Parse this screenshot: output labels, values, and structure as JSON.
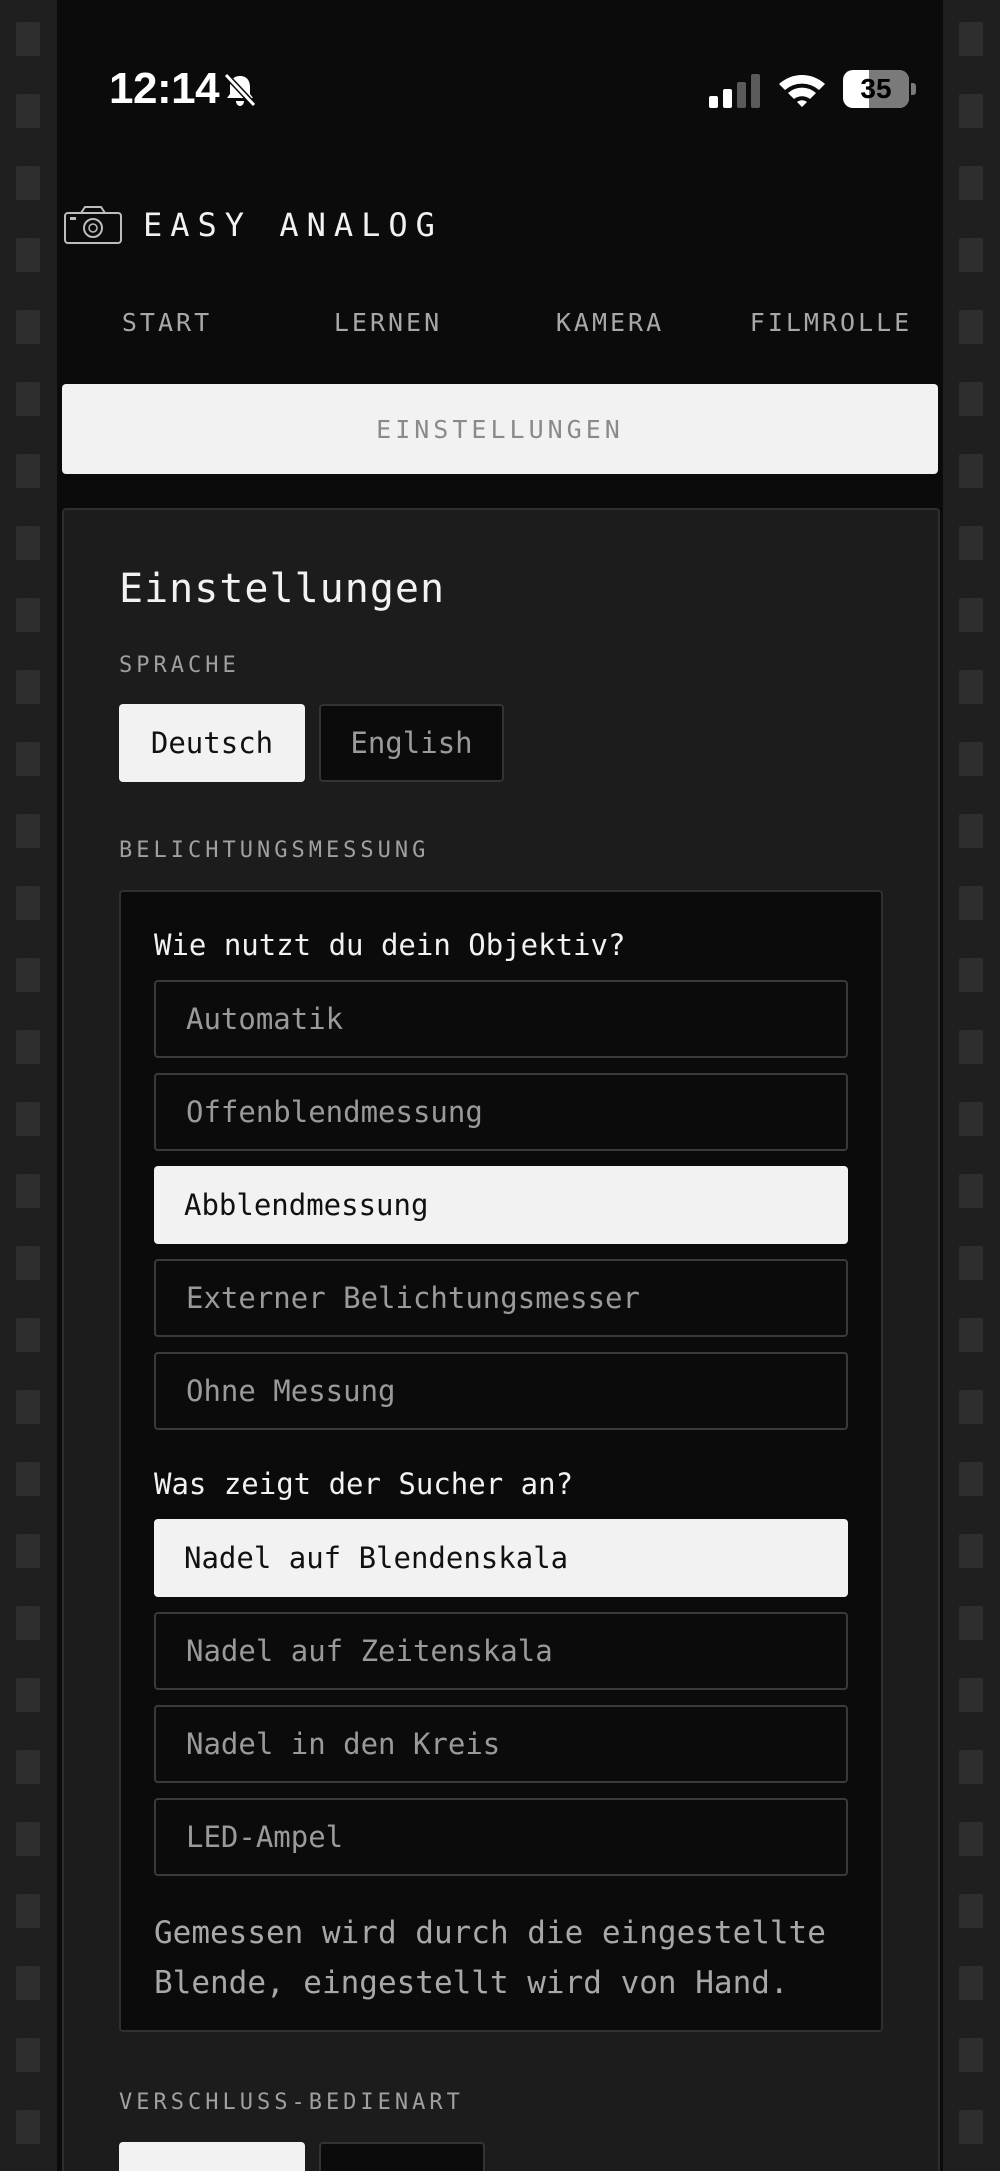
{
  "status": {
    "time": "12:14",
    "battery": "35"
  },
  "brand": {
    "title": "EASY ANALOG"
  },
  "nav": {
    "items": [
      "START",
      "LERNEN",
      "KAMERA",
      "FILMROLLE"
    ],
    "active": "EINSTELLUNGEN"
  },
  "settings": {
    "title": "Einstellungen",
    "language": {
      "label": "SPRACHE",
      "options": [
        "Deutsch",
        "English"
      ],
      "selected": "Deutsch"
    },
    "metering": {
      "label": "BELICHTUNGSMESSUNG",
      "q1": "Wie nutzt du dein Objektiv?",
      "lens_options": [
        "Automatik",
        "Offenblendmessung",
        "Abblendmessung",
        "Externer Belichtungsmesser",
        "Ohne Messung"
      ],
      "lens_selected": "Abblendmessung",
      "q2": "Was zeigt der Sucher an?",
      "viewfinder_options": [
        "Nadel auf Blendenskala",
        "Nadel auf Zeitenskala",
        "Nadel in den Kreis",
        "LED-Ampel"
      ],
      "viewfinder_selected": "Nadel auf Blendenskala",
      "description": "Gemessen wird durch die eingestellte Blende, eingestellt wird von Hand."
    },
    "shutter": {
      "label": "VERSCHLUSS-BEDIENART"
    }
  },
  "colors": {
    "background": "#0b0b0b",
    "card": "#1c1c1c",
    "selected": "#f2f2f2",
    "muted_text": "#9a9a9a"
  }
}
